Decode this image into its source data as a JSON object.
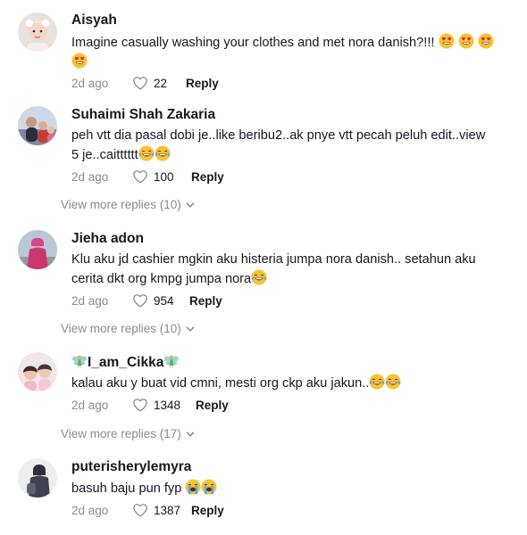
{
  "comments": [
    {
      "username": "Aisyah",
      "text_lines": [
        "Imagine casually washing your clothes and met nora danish?!!!",
        ""
      ],
      "emoji_line1": [
        "heart-eyes-emoji",
        "heart-eyes-emoji",
        "heart-eyes-emoji"
      ],
      "emoji_line2": [
        "heart-eyes-emoji"
      ],
      "time": "2d ago",
      "likes": "22",
      "reply_label": "Reply"
    },
    {
      "username": "Suhaimi Shah Zakaria",
      "text_lines": [
        "peh vtt dia pasal dobi je..like beribu2..ak pnye vtt pecah peluh edit..view",
        "5 je..caitttttt"
      ],
      "emoji_line2": [
        "tears-of-joy-emoji",
        "tears-of-joy-emoji"
      ],
      "time": "2d ago",
      "likes": "100",
      "reply_label": "Reply",
      "view_more": "View more replies (10)"
    },
    {
      "username": "Jieha adon",
      "text_lines": [
        "Klu aku jd cashier mgkin aku histeria jumpa nora danish.. setahun aku",
        "cerita dkt org kmpg jumpa nora"
      ],
      "emoji_line2": [
        "tears-of-joy-emoji"
      ],
      "time": "2d ago",
      "likes": "954",
      "reply_label": "Reply",
      "view_more": "View more replies (10)"
    },
    {
      "username": "I_am_Cikka",
      "text_lines": [
        "kalau aku y buat vid cmni, mesti org ckp aku jakun.."
      ],
      "emoji_line1": [
        "tears-of-joy-emoji",
        "tears-of-joy-emoji"
      ],
      "time": "2d ago",
      "likes": "1348",
      "reply_label": "Reply",
      "view_more": "View more replies (17)"
    },
    {
      "username": "puterisherylemyra",
      "text_lines": [
        "basuh baju pun fyp"
      ],
      "emoji_line1": [
        "crying-emoji",
        "crying-emoji"
      ],
      "time": "2d ago",
      "likes": "1387",
      "reply_label": "Reply"
    }
  ],
  "colors": {
    "text": "#161823",
    "muted": "#8a8b91",
    "emoji_yellow": "#f7c236",
    "heart_red": "#e5262f"
  }
}
